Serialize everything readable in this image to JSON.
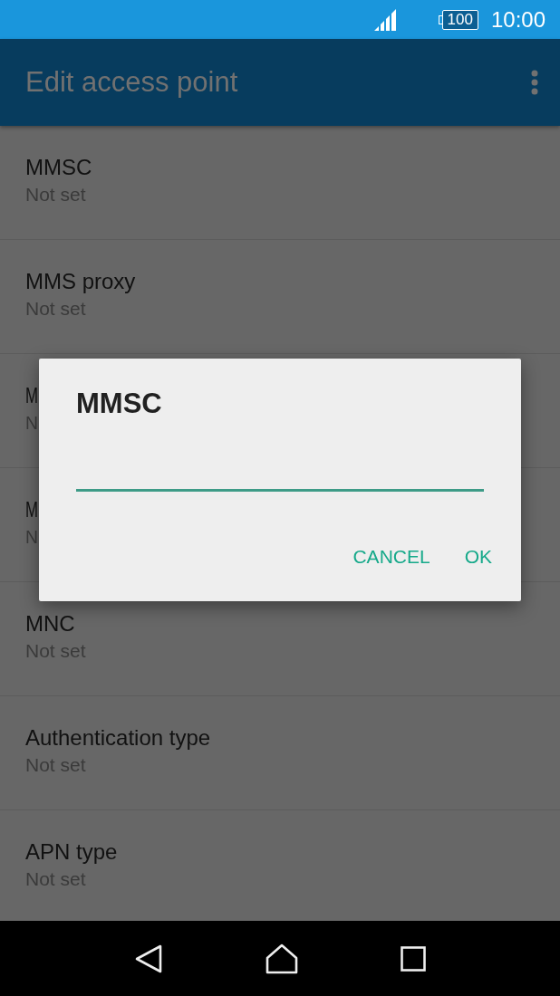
{
  "status_bar": {
    "battery": "100",
    "time": "10:00"
  },
  "app_bar": {
    "title": "Edit access point"
  },
  "settings": [
    {
      "title": "MMSC",
      "value": "Not set"
    },
    {
      "title": "MMS proxy",
      "value": "Not set"
    },
    {
      "title": "M",
      "value": "N"
    },
    {
      "title": "M",
      "value": "N"
    },
    {
      "title": "MNC",
      "value": "Not set"
    },
    {
      "title": "Authentication type",
      "value": "Not set"
    },
    {
      "title": "APN type",
      "value": "Not set"
    }
  ],
  "dialog": {
    "title": "MMSC",
    "buttons": [
      "CANCEL",
      "OK"
    ]
  }
}
